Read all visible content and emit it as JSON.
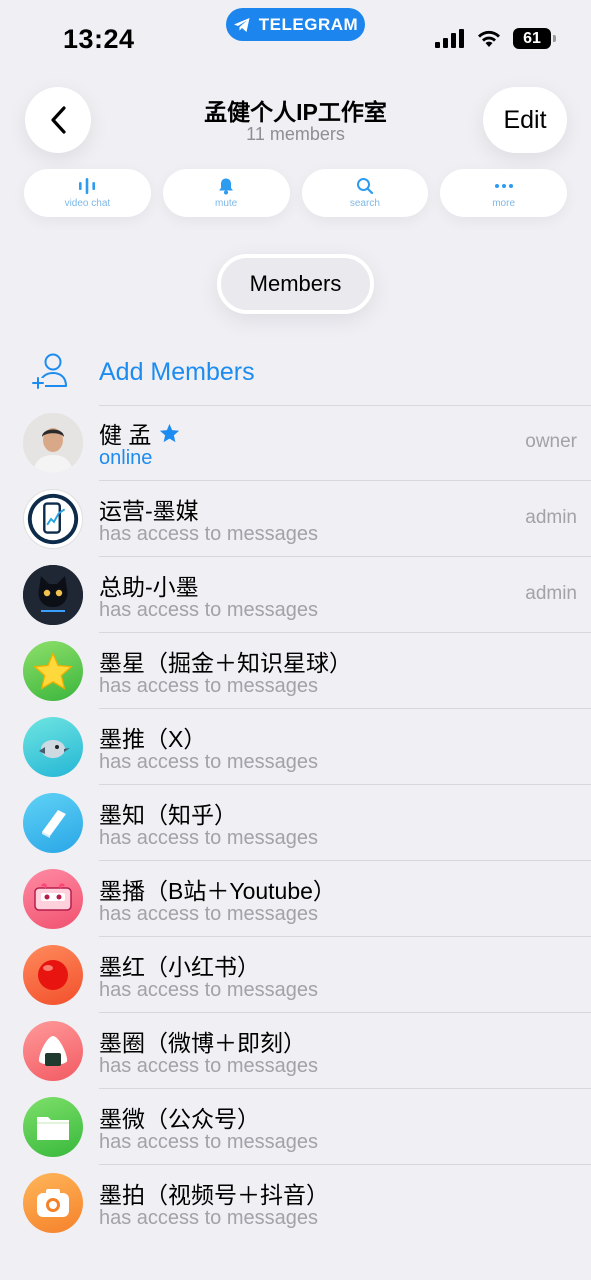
{
  "status_bar": {
    "time": "13:24",
    "app_pill": "TELEGRAM",
    "battery": "61"
  },
  "header": {
    "title": "孟健个人IP工作室",
    "subtitle": "11 members",
    "edit_label": "Edit"
  },
  "actions": [
    {
      "label": "video chat",
      "icon": "waveform-icon"
    },
    {
      "label": "mute",
      "icon": "bell-icon"
    },
    {
      "label": "search",
      "icon": "search-icon"
    },
    {
      "label": "more",
      "icon": "more-icon"
    }
  ],
  "members_tab": "Members",
  "add_members": "Add Members",
  "members": [
    {
      "name": "健 孟",
      "status": "online",
      "role": "owner",
      "starred": true,
      "avatar": "photo"
    },
    {
      "name": "运营-墨媒",
      "status": "has access to messages",
      "role": "admin",
      "avatar": "phone-chart"
    },
    {
      "name": "总助-小墨",
      "status": "has access to messages",
      "role": "admin",
      "avatar": "black-cat"
    },
    {
      "name": "墨星（掘金＋知识星球）",
      "status": "has access to messages",
      "role": "",
      "avatar": "star"
    },
    {
      "name": "墨推（X）",
      "status": "has access to messages",
      "role": "",
      "avatar": "bird"
    },
    {
      "name": "墨知（知乎）",
      "status": "has access to messages",
      "role": "",
      "avatar": "book"
    },
    {
      "name": "墨播（B站＋Youtube）",
      "status": "has access to messages",
      "role": "",
      "avatar": "cassette"
    },
    {
      "name": "墨红（小红书）",
      "status": "has access to messages",
      "role": "",
      "avatar": "red-ball"
    },
    {
      "name": "墨圈（微博＋即刻）",
      "status": "has access to messages",
      "role": "",
      "avatar": "onigiri"
    },
    {
      "name": "墨微（公众号）",
      "status": "has access to messages",
      "role": "",
      "avatar": "folder"
    },
    {
      "name": "墨拍（视频号＋抖音）",
      "status": "has access to messages",
      "role": "",
      "avatar": "camera"
    }
  ],
  "colors": {
    "accent": "#1d8cf0",
    "background": "#efeff4",
    "secondary_text": "#a2a2a7"
  }
}
